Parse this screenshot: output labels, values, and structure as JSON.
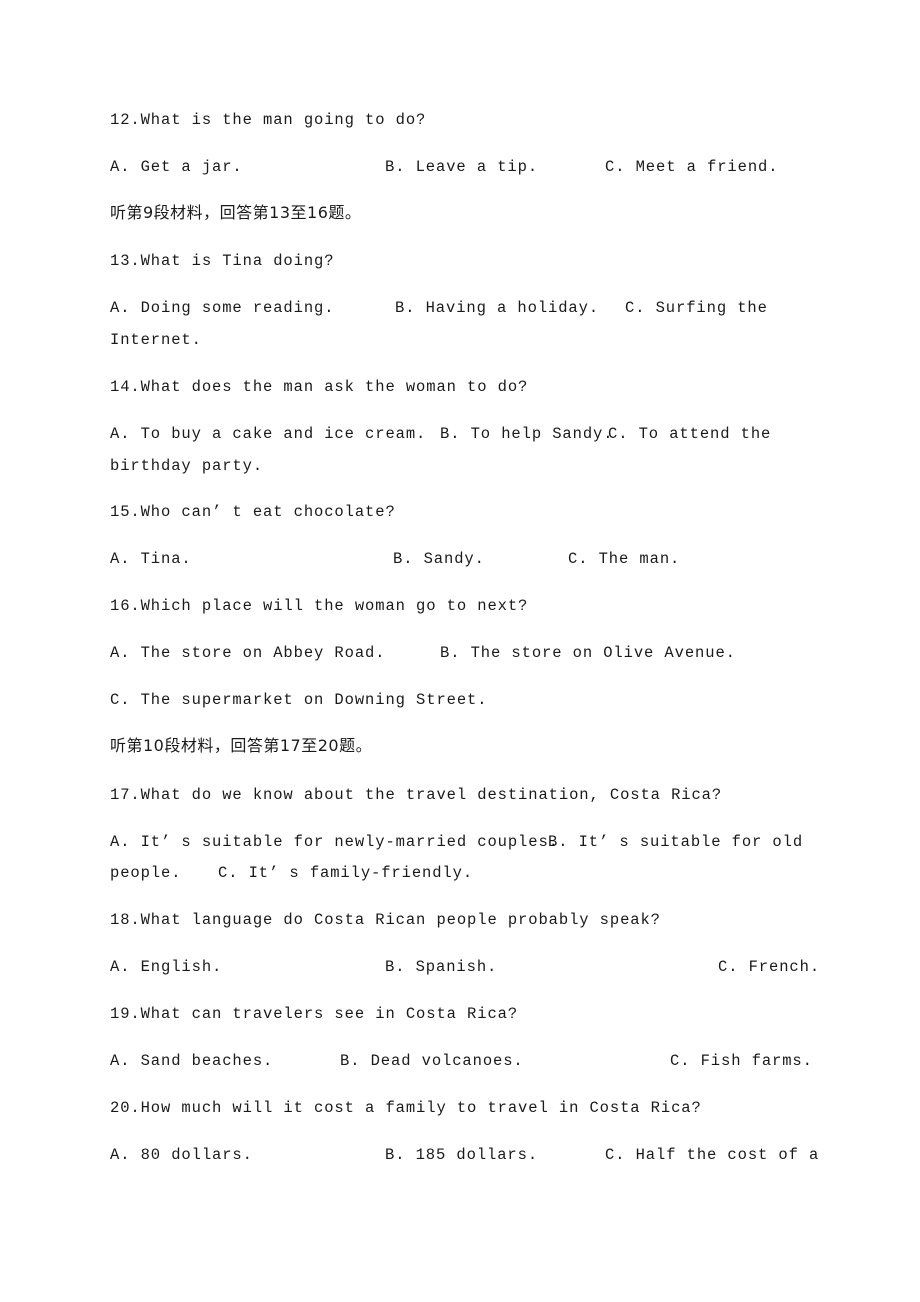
{
  "document": {
    "kind": "english-listening-exam-page",
    "page_background": "#ffffff",
    "text_color": "#1a1a1a"
  },
  "blocks": [
    {
      "id": "q12",
      "type": "question",
      "number": "12.",
      "stem": "12.What is the man going to do?",
      "options_line": "A. Get a jar.",
      "option_b": "B. Leave a tip.",
      "option_c": "C. Meet a friend."
    },
    {
      "id": "section9",
      "type": "section-heading-cn",
      "text": "听第9段材料，回答第13至16题。"
    },
    {
      "id": "q13",
      "type": "question",
      "number": "13.",
      "stem": "13.What is Tina doing?",
      "option_a": "A. Doing some reading.",
      "option_b": "B. Having a holiday.",
      "option_c": "C. Surfing the",
      "option_c_wrap": "Internet."
    },
    {
      "id": "q14",
      "type": "question",
      "number": "14.",
      "stem": "14.What does the man ask the woman to do?",
      "option_a": "A. To buy a cake and ice cream.",
      "option_b": "B. To help Sandy.",
      "option_c": "C. To attend the",
      "option_c_wrap": "birthday party."
    },
    {
      "id": "q15",
      "type": "question",
      "number": "15.",
      "stem": "15.Who can’ t eat chocolate?",
      "option_a": "A. Tina.",
      "option_b": "B. Sandy.",
      "option_c": "C. The man."
    },
    {
      "id": "q16",
      "type": "question",
      "number": "16.",
      "stem": "16.Which place will the woman go to next?",
      "option_a": "A. The store on Abbey Road.",
      "option_b": "B. The store on Olive Avenue.",
      "option_c": "C. The supermarket on Downing Street."
    },
    {
      "id": "section10",
      "type": "section-heading-cn",
      "text": "听第10段材料，回答第17至20题。"
    },
    {
      "id": "q17",
      "type": "question",
      "number": "17.",
      "stem": "17.What do we know about the travel destination, Costa Rica?",
      "option_a": "A. It’ s suitable for newly-married couples.",
      "option_b": "B. It’ s suitable for old",
      "option_b_wrap": "people.",
      "option_c": "C. It’ s family-friendly."
    },
    {
      "id": "q18",
      "type": "question",
      "number": "18.",
      "stem": "18.What language do Costa Rican people probably speak?",
      "option_a": "A. English.",
      "option_b": "B. Spanish.",
      "option_c": "C. French."
    },
    {
      "id": "q19",
      "type": "question",
      "number": "19.",
      "stem": "19.What can travelers see in Costa Rica?",
      "option_a": "A. Sand beaches.",
      "option_b": "B. Dead volcanoes.",
      "option_c": "C. Fish farms."
    },
    {
      "id": "q20",
      "type": "question",
      "number": "20.",
      "stem": "20.How much will it cost a family to travel in Costa Rica?",
      "option_a": "A. 80 dollars.",
      "option_b": "B. 185 dollars.",
      "option_c": "C. Half the cost of a"
    }
  ]
}
